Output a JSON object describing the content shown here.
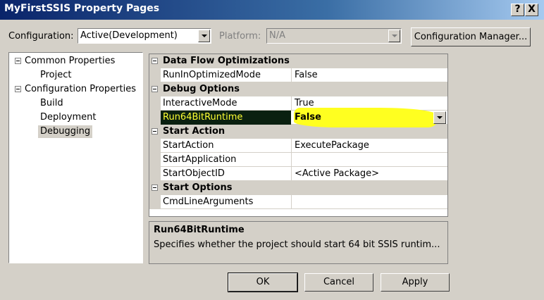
{
  "window": {
    "title": "MyFirstSSIS Property Pages",
    "help_glyph": "?",
    "close_glyph": "X"
  },
  "config": {
    "configuration_label": "Configuration:",
    "configuration_value": "Active(Development)",
    "platform_label": "Platform:",
    "platform_value": "N/A",
    "manager_button": "Configuration Manager..."
  },
  "tree": {
    "items": [
      {
        "label": "Common Properties",
        "level": 0,
        "expanded": true
      },
      {
        "label": "Project",
        "level": 1
      },
      {
        "label": "Configuration Properties",
        "level": 0,
        "expanded": true
      },
      {
        "label": "Build",
        "level": 1
      },
      {
        "label": "Deployment",
        "level": 1
      },
      {
        "label": "Debugging",
        "level": 1,
        "selected": true
      }
    ]
  },
  "grid": {
    "categories": [
      {
        "name": "Data Flow Optimizations",
        "props": [
          {
            "name": "RunInOptimizedMode",
            "value": "False"
          }
        ]
      },
      {
        "name": "Debug Options",
        "props": [
          {
            "name": "InteractiveMode",
            "value": "True"
          },
          {
            "name": "Run64BitRuntime",
            "value": "False",
            "selected": true
          }
        ]
      },
      {
        "name": "Start Action",
        "props": [
          {
            "name": "StartAction",
            "value": "ExecutePackage"
          },
          {
            "name": "StartApplication",
            "value": ""
          },
          {
            "name": "StartObjectID",
            "value": "<Active Package>"
          }
        ]
      },
      {
        "name": "Start Options",
        "props": [
          {
            "name": "CmdLineArguments",
            "value": ""
          }
        ]
      }
    ]
  },
  "description": {
    "title": "Run64BitRuntime",
    "text": "Specifies whether the project should start 64 bit SSIS runtim..."
  },
  "buttons": {
    "ok": "OK",
    "cancel": "Cancel",
    "apply": "Apply"
  },
  "colors": {
    "highlight": "#ffff20",
    "selected_name_bg": "#0a2010",
    "titlebar": "#0a246a"
  }
}
